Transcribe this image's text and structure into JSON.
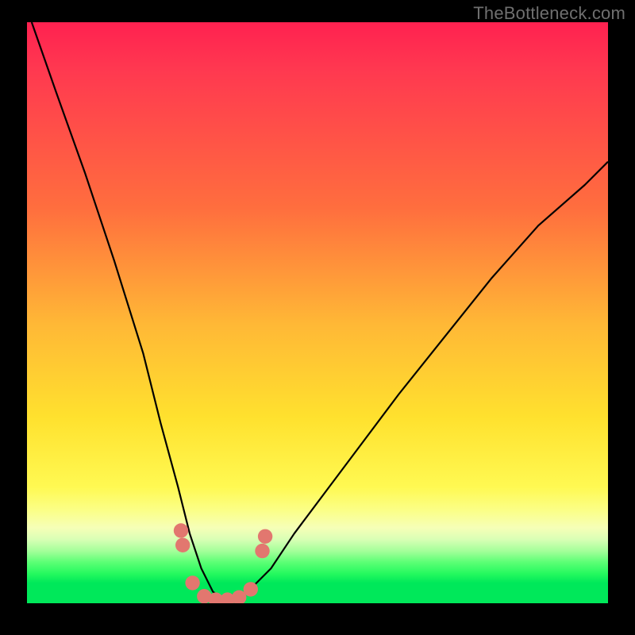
{
  "watermark": "TheBottleneck.com",
  "chart_data": {
    "type": "line",
    "title": "",
    "xlabel": "",
    "ylabel": "",
    "xlim": [
      0,
      100
    ],
    "ylim": [
      0,
      100
    ],
    "grid": false,
    "legend": false,
    "background_gradient": {
      "stops": [
        {
          "pct": 0,
          "color": "#ff2150"
        },
        {
          "pct": 32,
          "color": "#ff6e3e"
        },
        {
          "pct": 52,
          "color": "#ffb836"
        },
        {
          "pct": 68,
          "color": "#ffe12e"
        },
        {
          "pct": 84,
          "color": "#fbff87"
        },
        {
          "pct": 92,
          "color": "#5aff74"
        },
        {
          "pct": 100,
          "color": "#00e85a"
        }
      ]
    },
    "series": [
      {
        "name": "bottleneck-curve",
        "x": [
          0.8,
          5,
          10,
          15,
          20,
          23,
          26,
          28,
          30,
          32,
          34,
          36,
          38,
          42,
          46,
          52,
          58,
          64,
          72,
          80,
          88,
          96,
          100
        ],
        "y": [
          100,
          88,
          74,
          59,
          43,
          31,
          20,
          12,
          6,
          2,
          0.5,
          0.5,
          2,
          6,
          12,
          20,
          28,
          36,
          46,
          56,
          65,
          72,
          76
        ]
      }
    ],
    "markers": {
      "name": "highlight-points",
      "color": "#e2776f",
      "points": [
        {
          "x": 26.5,
          "y": 12.5,
          "r": 1.4
        },
        {
          "x": 26.8,
          "y": 10.0,
          "r": 1.4
        },
        {
          "x": 28.5,
          "y": 3.5,
          "r": 1.4
        },
        {
          "x": 30.5,
          "y": 1.2,
          "r": 1.4
        },
        {
          "x": 32.5,
          "y": 0.6,
          "r": 1.4
        },
        {
          "x": 34.5,
          "y": 0.6,
          "r": 1.4
        },
        {
          "x": 36.5,
          "y": 1.0,
          "r": 1.4
        },
        {
          "x": 38.5,
          "y": 2.4,
          "r": 1.4
        },
        {
          "x": 40.5,
          "y": 9.0,
          "r": 1.4
        },
        {
          "x": 41.0,
          "y": 11.5,
          "r": 1.4
        }
      ]
    }
  }
}
